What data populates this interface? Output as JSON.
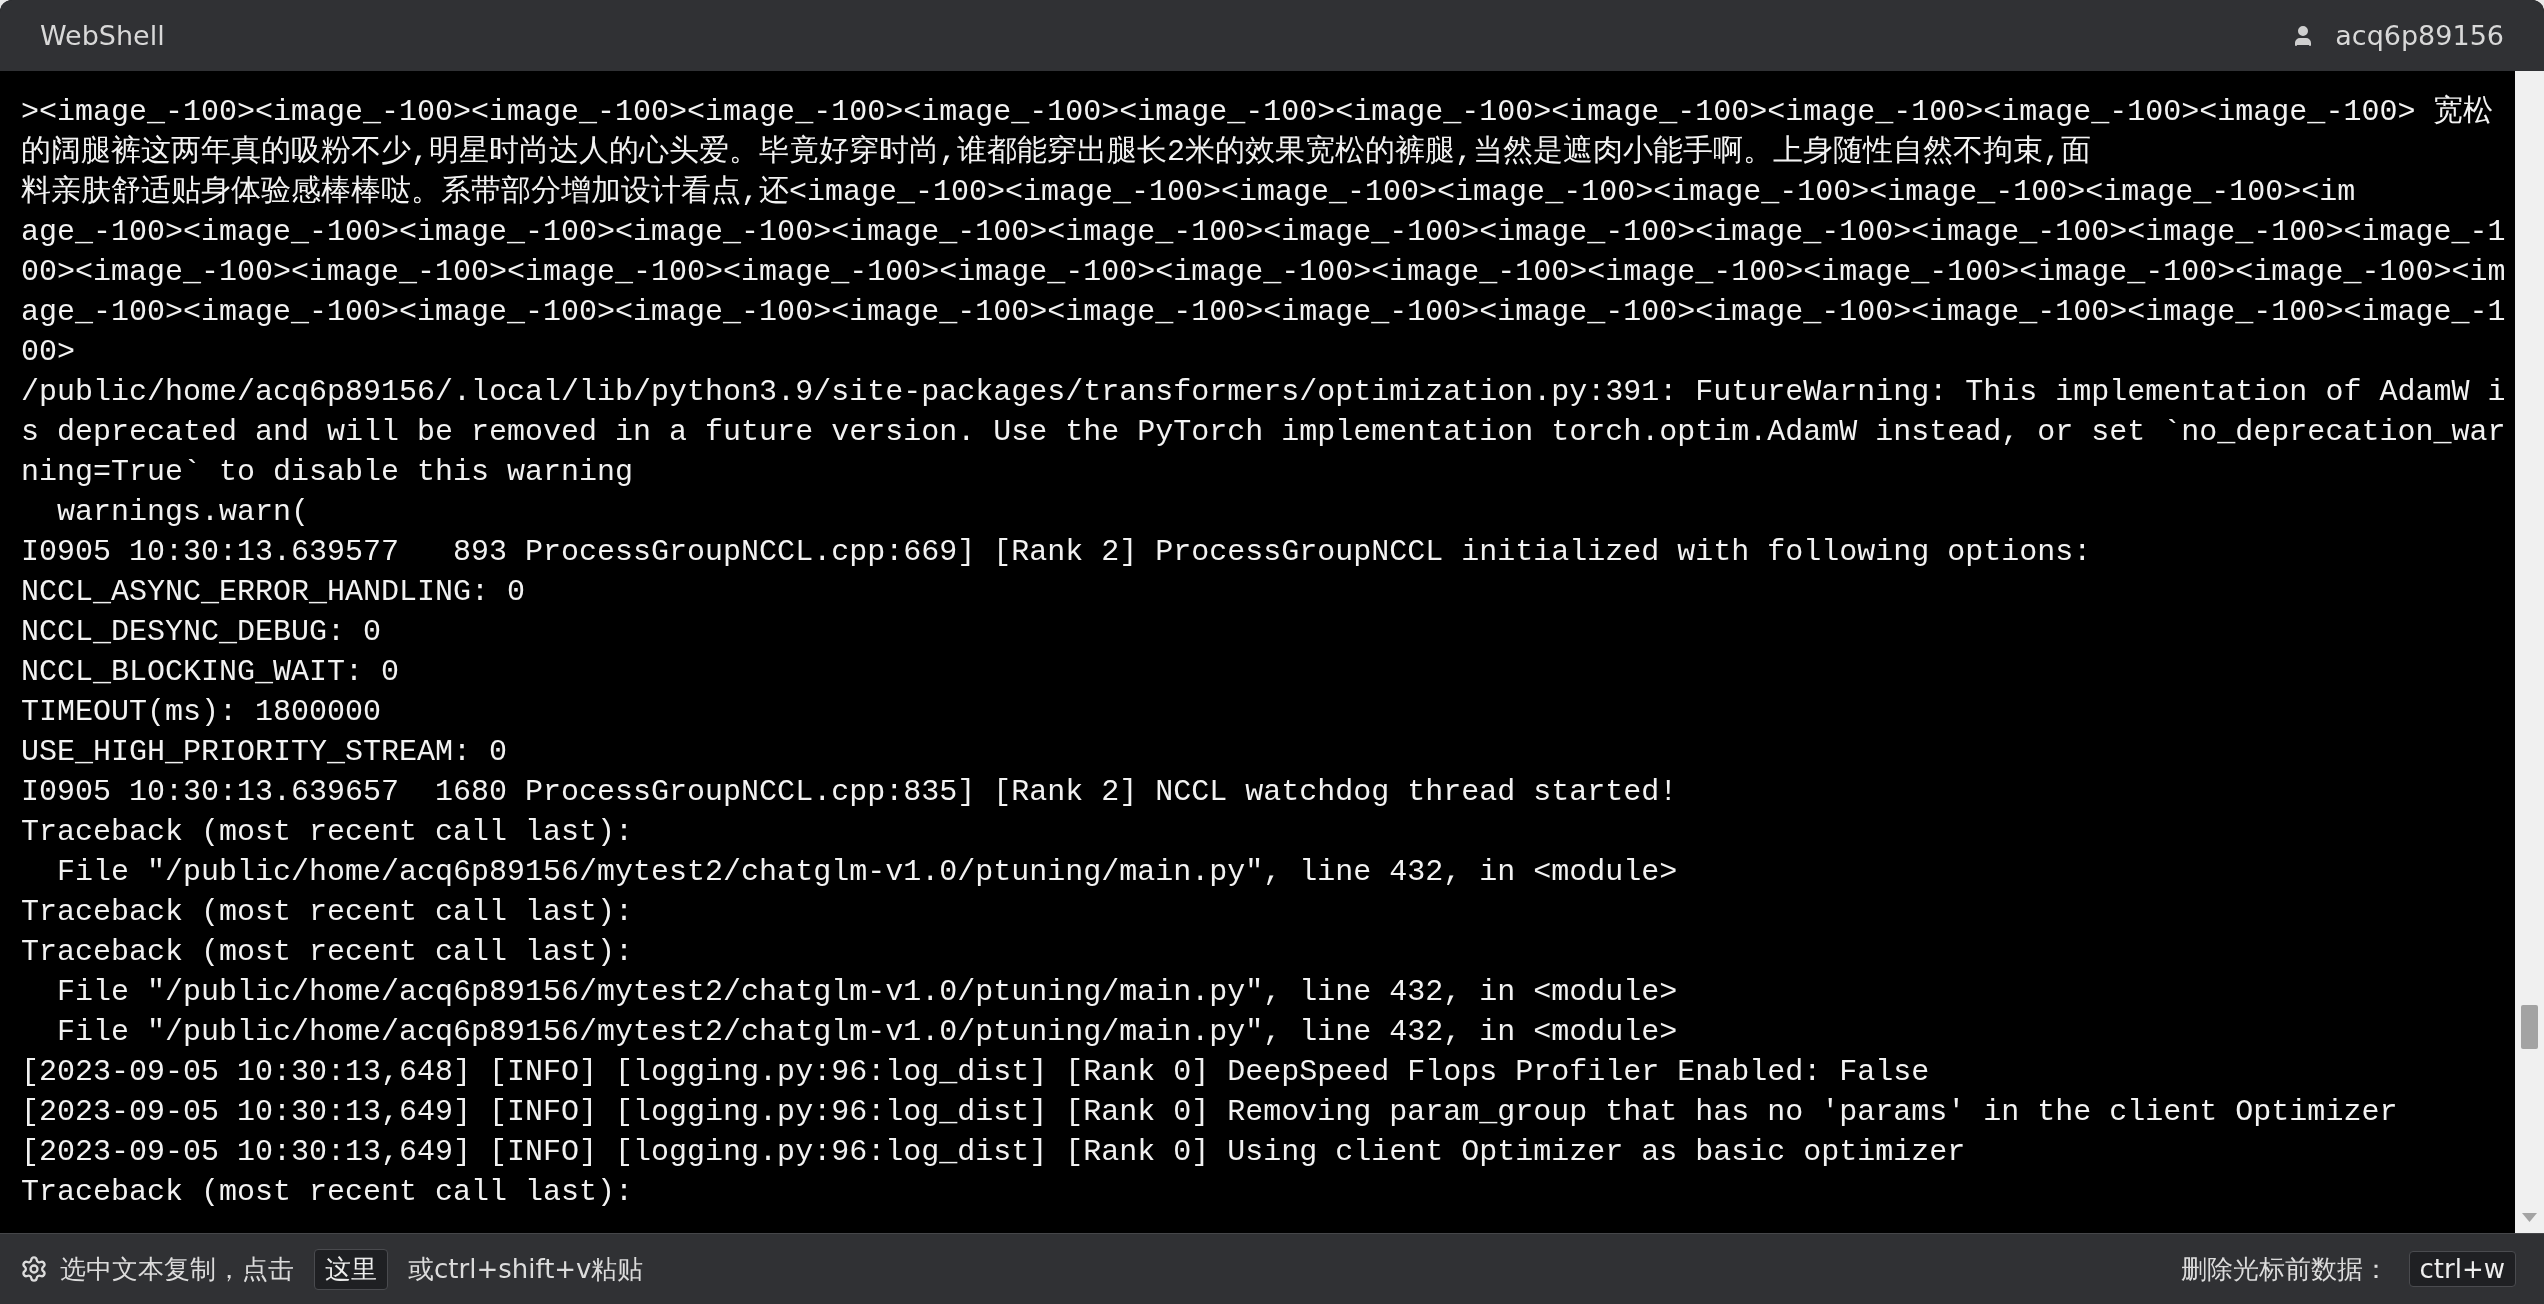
{
  "window": {
    "title": "WebShell",
    "user": "acq6p89156"
  },
  "terminal": {
    "lines": [
      "><image_-100><image_-100><image_-100><image_-100><image_-100><image_-100><image_-100><image_-100><image_-100><image_-100><image_-100> 宽松",
      "的阔腿裤这两年真的吸粉不少,明星时尚达人的心头爱。毕竟好穿时尚,谁都能穿出腿长2米的效果宽松的裤腿,当然是遮肉小能手啊。上身随性自然不拘束,面",
      "料亲肤舒适贴身体验感棒棒哒。系带部分增加设计看点,还<image_-100><image_-100><image_-100><image_-100><image_-100><image_-100><image_-100><im",
      "age_-100><image_-100><image_-100><image_-100><image_-100><image_-100><image_-100><image_-100><image_-100><image_-100><image_-100><image_-1",
      "00><image_-100><image_-100><image_-100><image_-100><image_-100><image_-100><image_-100><image_-100><image_-100><image_-100><image_-100><im",
      "age_-100><image_-100><image_-100><image_-100><image_-100><image_-100><image_-100><image_-100><image_-100><image_-100><image_-100><image_-1",
      "00>",
      "/public/home/acq6p89156/.local/lib/python3.9/site-packages/transformers/optimization.py:391: FutureWarning: This implementation of AdamW i",
      "s deprecated and will be removed in a future version. Use the PyTorch implementation torch.optim.AdamW instead, or set `no_deprecation_war",
      "ning=True` to disable this warning",
      "  warnings.warn(",
      "I0905 10:30:13.639577   893 ProcessGroupNCCL.cpp:669] [Rank 2] ProcessGroupNCCL initialized with following options:",
      "NCCL_ASYNC_ERROR_HANDLING: 0",
      "NCCL_DESYNC_DEBUG: 0",
      "NCCL_BLOCKING_WAIT: 0",
      "TIMEOUT(ms): 1800000",
      "USE_HIGH_PRIORITY_STREAM: 0",
      "I0905 10:30:13.639657  1680 ProcessGroupNCCL.cpp:835] [Rank 2] NCCL watchdog thread started!",
      "Traceback (most recent call last):",
      "  File \"/public/home/acq6p89156/mytest2/chatglm-v1.0/ptuning/main.py\", line 432, in <module>",
      "Traceback (most recent call last):",
      "Traceback (most recent call last):",
      "  File \"/public/home/acq6p89156/mytest2/chatglm-v1.0/ptuning/main.py\", line 432, in <module>",
      "  File \"/public/home/acq6p89156/mytest2/chatglm-v1.0/ptuning/main.py\", line 432, in <module>",
      "[2023-09-05 10:30:13,648] [INFO] [logging.py:96:log_dist] [Rank 0] DeepSpeed Flops Profiler Enabled: False",
      "[2023-09-05 10:30:13,649] [INFO] [logging.py:96:log_dist] [Rank 0] Removing param_group that has no 'params' in the client Optimizer",
      "[2023-09-05 10:30:13,649] [INFO] [logging.py:96:log_dist] [Rank 0] Using client Optimizer as basic optimizer",
      "Traceback (most recent call last):"
    ]
  },
  "status_bar": {
    "hint_prefix": "选中文本复制，点击",
    "copy_button": "这里",
    "hint_suffix": "或ctrl+shift+v粘贴",
    "delete_label": "删除光标前数据：",
    "delete_key": "ctrl+w"
  }
}
